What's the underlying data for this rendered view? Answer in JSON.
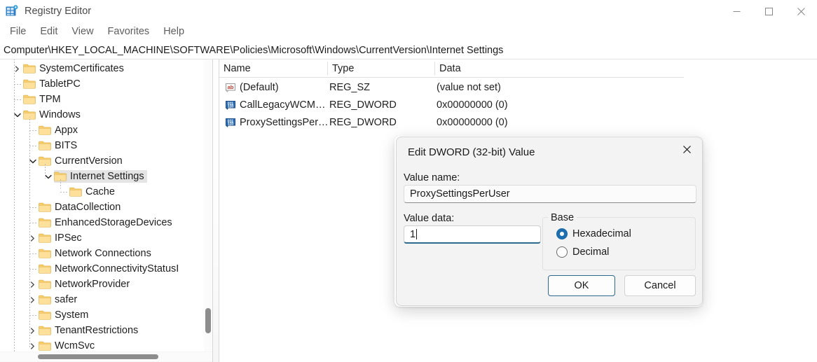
{
  "window": {
    "title": "Registry Editor",
    "icon": "registry-editor-icon",
    "controls": {
      "minimize": "—",
      "maximize": "☐",
      "close": "✕"
    }
  },
  "menubar": {
    "items": [
      "File",
      "Edit",
      "View",
      "Favorites",
      "Help"
    ]
  },
  "address": {
    "path": "Computer\\HKEY_LOCAL_MACHINE\\SOFTWARE\\Policies\\Microsoft\\Windows\\CurrentVersion\\Internet Settings"
  },
  "tree": {
    "items": [
      {
        "label": "SystemCertificates",
        "depth": 1,
        "expander": "collapsed",
        "selected": false
      },
      {
        "label": "TabletPC",
        "depth": 1,
        "expander": "none",
        "selected": false
      },
      {
        "label": "TPM",
        "depth": 1,
        "expander": "none",
        "selected": false
      },
      {
        "label": "Windows",
        "depth": 1,
        "expander": "expanded",
        "selected": false
      },
      {
        "label": "Appx",
        "depth": 2,
        "expander": "none",
        "selected": false
      },
      {
        "label": "BITS",
        "depth": 2,
        "expander": "none",
        "selected": false
      },
      {
        "label": "CurrentVersion",
        "depth": 2,
        "expander": "expanded",
        "selected": false
      },
      {
        "label": "Internet Settings",
        "depth": 3,
        "expander": "expanded",
        "selected": true
      },
      {
        "label": "Cache",
        "depth": 4,
        "expander": "none",
        "selected": false
      },
      {
        "label": "DataCollection",
        "depth": 2,
        "expander": "none",
        "selected": false
      },
      {
        "label": "EnhancedStorageDevices",
        "depth": 2,
        "expander": "none",
        "selected": false
      },
      {
        "label": "IPSec",
        "depth": 2,
        "expander": "collapsed",
        "selected": false
      },
      {
        "label": "Network Connections",
        "depth": 2,
        "expander": "none",
        "selected": false
      },
      {
        "label": "NetworkConnectivityStatusI",
        "depth": 2,
        "expander": "none",
        "selected": false
      },
      {
        "label": "NetworkProvider",
        "depth": 2,
        "expander": "collapsed",
        "selected": false
      },
      {
        "label": "safer",
        "depth": 2,
        "expander": "collapsed",
        "selected": false
      },
      {
        "label": "System",
        "depth": 2,
        "expander": "none",
        "selected": false
      },
      {
        "label": "TenantRestrictions",
        "depth": 2,
        "expander": "collapsed",
        "selected": false
      },
      {
        "label": "WcmSvc",
        "depth": 2,
        "expander": "collapsed",
        "selected": false
      }
    ]
  },
  "list": {
    "columns": [
      "Name",
      "Type",
      "Data"
    ],
    "rows": [
      {
        "icon": "reg-sz-icon",
        "name": "(Default)",
        "type": "REG_SZ",
        "data": "(value not set)"
      },
      {
        "icon": "reg-dword-icon",
        "name": "CallLegacyWCM…",
        "type": "REG_DWORD",
        "data": "0x00000000 (0)"
      },
      {
        "icon": "reg-dword-icon",
        "name": "ProxySettingsPer…",
        "type": "REG_DWORD",
        "data": "0x00000000 (0)"
      }
    ]
  },
  "dialog": {
    "title": "Edit DWORD (32-bit) Value",
    "close_label": "✕",
    "value_name_label": "Value name:",
    "value_name": "ProxySettingsPerUser",
    "value_data_label": "Value data:",
    "value_data": "1",
    "base_group_label": "Base",
    "base_options": [
      {
        "label": "Hexadecimal",
        "selected": true
      },
      {
        "label": "Decimal",
        "selected": false
      }
    ],
    "ok_label": "OK",
    "cancel_label": "Cancel"
  },
  "colors": {
    "accent": "#2c6a8e",
    "radio_on": "#1e6fb0",
    "selection": "#e4e4e4",
    "folder": "#ffd878",
    "reg_sz_icon": "#c0392b",
    "reg_dword_icon": "#2f6fb5"
  }
}
